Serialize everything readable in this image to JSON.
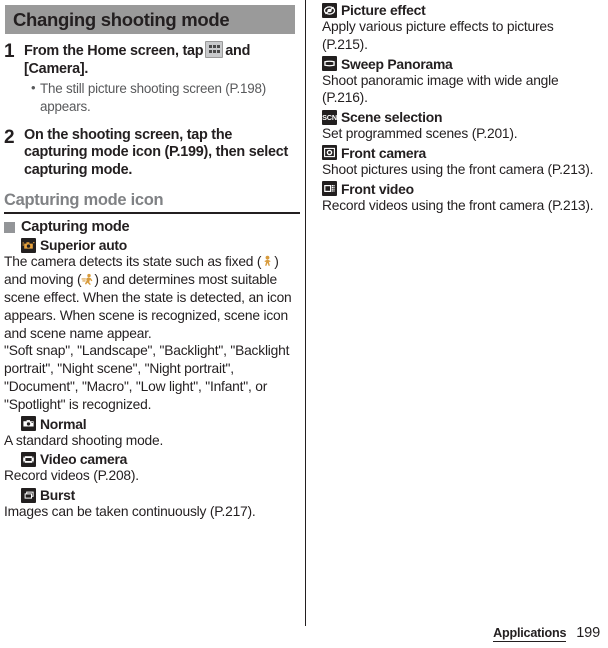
{
  "section": {
    "title": "Changing shooting mode"
  },
  "steps": [
    {
      "number": "1",
      "title_before": "From the Home screen, tap",
      "icon": "apps-grid-icon",
      "title_after": "and [Camera].",
      "bullet_dot": "•",
      "bullet_text": "The still picture shooting screen (P.198) appears."
    },
    {
      "number": "2",
      "title_before": "On the shooting screen, tap the capturing mode icon (P.199), then select capturing mode.",
      "icon": "",
      "title_after": "",
      "bullet_dot": "",
      "bullet_text": ""
    }
  ],
  "subheading": {
    "label": "Capturing mode icon"
  },
  "group": {
    "label": "Capturing mode"
  },
  "left_modes": [
    {
      "icon": "superior-auto-icon",
      "label": "Superior auto",
      "desc_part1": "The camera detects its state such as fixed (",
      "inline_icon_1": "fixed-person-icon",
      "desc_part2": ") and moving (",
      "inline_icon_2": "moving-person-icon",
      "desc_part3": ") and determines most suitable scene effect. When the state is detected, an icon appears. When scene is recognized, scene icon and scene name appear.",
      "desc_part4": "\"Soft snap\", \"Landscape\", \"Backlight\", \"Backlight portrait\", \"Night scene\", \"Night portrait\", \"Document\", \"Macro\", \"Low light\", \"Infant\", or \"Spotlight\" is recognized."
    },
    {
      "icon": "normal-camera-icon",
      "label": "Normal",
      "desc": "A standard shooting mode."
    },
    {
      "icon": "video-camera-icon",
      "label": "Video camera",
      "desc": "Record videos (P.208)."
    },
    {
      "icon": "burst-icon",
      "label": "Burst",
      "desc": "Images can be taken continuously (P.217)."
    }
  ],
  "right_modes": [
    {
      "icon": "picture-effect-icon",
      "label": "Picture effect",
      "desc": "Apply various picture effects to pictures (P.215)."
    },
    {
      "icon": "sweep-panorama-icon",
      "label": "Sweep Panorama",
      "desc": "Shoot panoramic image with wide angle (P.216)."
    },
    {
      "icon": "scene-selection-icon",
      "icon_text": "SCN",
      "label": "Scene selection",
      "desc": "Set programmed scenes (P.201)."
    },
    {
      "icon": "front-camera-icon",
      "label": "Front camera",
      "desc": "Shoot pictures using the front camera (P.213)."
    },
    {
      "icon": "front-video-icon",
      "label": "Front video",
      "desc": "Record videos using the front camera (P.213)."
    }
  ],
  "footer": {
    "label": "Applications",
    "page": "199"
  },
  "colors": {
    "section_bar": "#9a9a9a",
    "subheading_gray": "#808285",
    "icon_dark": "#221f1f",
    "icon_accent": "#e8a33d",
    "text": "#231f20"
  }
}
